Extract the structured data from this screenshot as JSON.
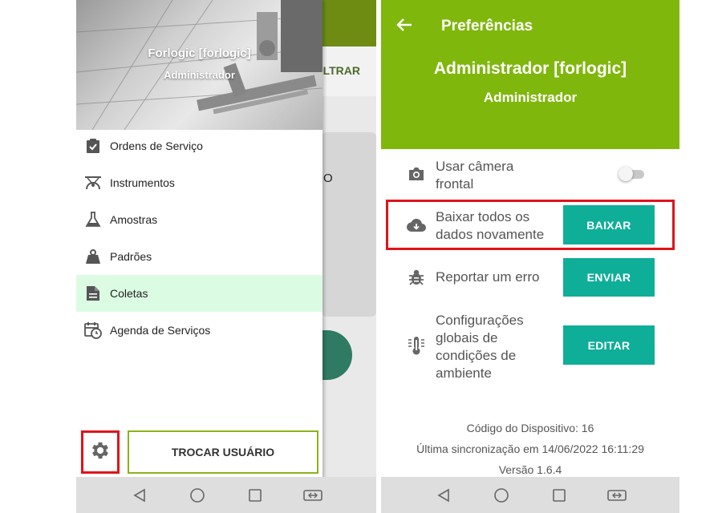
{
  "left": {
    "background": {
      "filter_label": "ILTRAR",
      "card_char": "O"
    },
    "drawer_header": {
      "user_name": "Forlogic [forlogic]",
      "user_role": "Administrador"
    },
    "menu": [
      {
        "label": "Ordens de Serviço",
        "icon": "clipboard-check-icon"
      },
      {
        "label": "Instrumentos",
        "icon": "scale-icon"
      },
      {
        "label": "Amostras",
        "icon": "flask-icon"
      },
      {
        "label": "Padrões",
        "icon": "weight-icon"
      },
      {
        "label": "Coletas",
        "icon": "file-icon",
        "active": true
      },
      {
        "label": "Agenda de Serviços",
        "icon": "calendar-clock-icon"
      }
    ],
    "switch_user_label": "TROCAR USUÁRIO"
  },
  "right": {
    "title": "Preferências",
    "user_name": "Administrador [forlogic]",
    "user_role": "Administrador",
    "prefs": {
      "camera": {
        "line1": "Usar câmera",
        "line2": "frontal",
        "toggle_on": false
      },
      "download": {
        "line1": "Baixar todos os",
        "line2": "dados novamente",
        "button": "BAIXAR"
      },
      "report": {
        "line1": "Reportar um erro",
        "button": "ENVIAR"
      },
      "config": {
        "line1": "Configurações",
        "line2": "globais de",
        "line3": "condições de",
        "line4": "ambiente",
        "button": "EDITAR"
      }
    },
    "info": {
      "device_code": "Código do Dispositivo: 16",
      "last_sync": "Última sincronização em 14/06/2022 16:11:29",
      "version": "Versão 1.6.4"
    }
  },
  "colors": {
    "header_green": "#80b70d",
    "button_teal": "#0fae98",
    "highlight_red": "#e0131a",
    "active_item": "#dcfbe3"
  }
}
